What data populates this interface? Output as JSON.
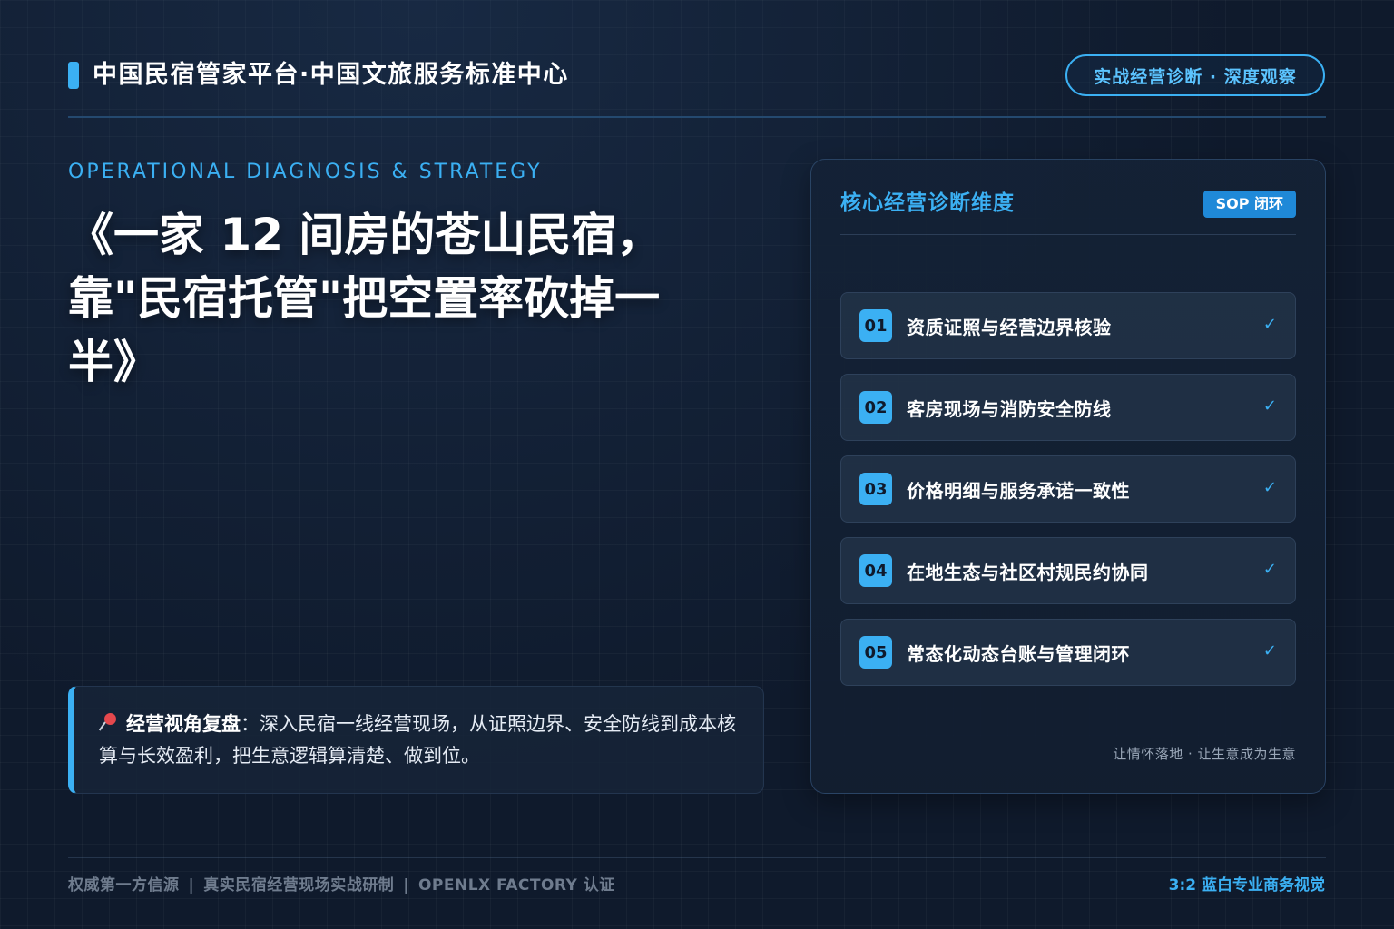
{
  "header": {
    "brand_title": "中国民宿管家平台·中国文旅服务标准中心",
    "badge": "实战经营诊断 · 深度观察"
  },
  "hero": {
    "eyebrow": "OPERATIONAL DIAGNOSIS & STRATEGY",
    "title_lines": [
      "《一家 12 间房的苍山民宿，",
      "靠\"民宿托管\"把空置率砍掉一",
      "半》"
    ]
  },
  "review": {
    "lead": "经营视角复盘",
    "colon": "：",
    "text": "深入民宿一线经营现场，从证照边界、安全防线到成本核算与长效盈利，把生意逻辑算清楚、做到位。",
    "icon": "pushpin-icon"
  },
  "panel": {
    "title": "核心经营诊断维度",
    "tag": "SOP 闭环",
    "items": [
      {
        "num": "01",
        "label": "资质证照与经营边界核验",
        "check": "✓"
      },
      {
        "num": "02",
        "label": "客房现场与消防安全防线",
        "check": "✓"
      },
      {
        "num": "03",
        "label": "价格明细与服务承诺一致性",
        "check": "✓"
      },
      {
        "num": "04",
        "label": "在地生态与社区村规民约协同",
        "check": "✓"
      },
      {
        "num": "05",
        "label": "常态化动态台账与管理闭环",
        "check": "✓"
      }
    ],
    "footer": "让情怀落地 · 让生意成为生意"
  },
  "footer": {
    "left_items": [
      "权威第一方信源",
      "真实民宿经营现场实战研制",
      "OPENLX FACTORY 认证"
    ],
    "separator": "|",
    "right": "3:2 蓝白专业商务视觉"
  },
  "colors": {
    "background": "#0f1a2c",
    "accent": "#3bb0f3",
    "tag": "#1f89d8",
    "pin": "#e5484d"
  }
}
